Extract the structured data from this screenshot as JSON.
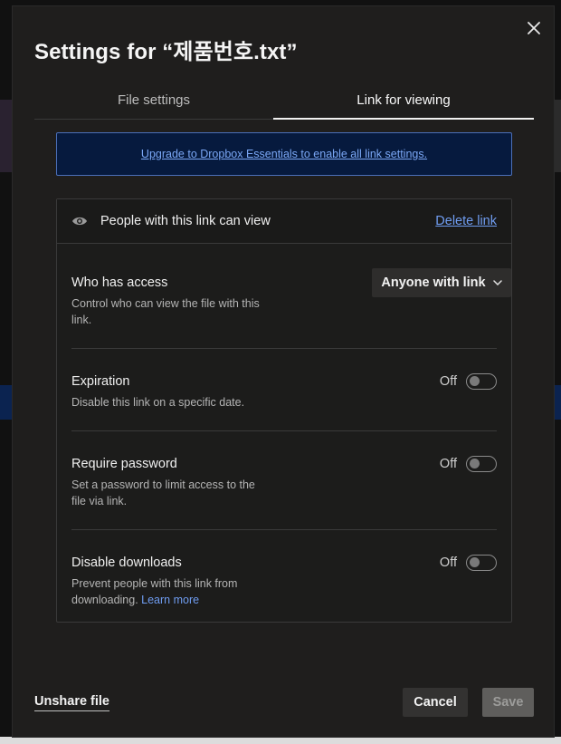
{
  "modal": {
    "title": "Settings for “제품번호.txt”",
    "close_icon": "close-icon"
  },
  "tabs": [
    {
      "label": "File settings",
      "active": false
    },
    {
      "label": "Link for viewing",
      "active": true
    }
  ],
  "banner": {
    "link_text": "Upgrade to Dropbox Essentials to enable all link settings."
  },
  "link_panel": {
    "header_label": "People with this link can view",
    "header_icon": "eye-icon",
    "delete_link": "Delete link",
    "who_has_access": {
      "title": "Who has access",
      "description": "Control who can view the file with this link.",
      "selected": "Anyone with link"
    },
    "expiration": {
      "title": "Expiration",
      "description": "Disable this link on a specific date.",
      "state": "Off"
    },
    "require_password": {
      "title": "Require password",
      "description": "Set a password to limit access to the file via link.",
      "state": "Off"
    },
    "disable_downloads": {
      "title": "Disable downloads",
      "description": "Prevent people with this link from downloading.",
      "learn_more": "Learn more",
      "state": "Off"
    }
  },
  "footer": {
    "unshare": "Unshare file",
    "cancel": "Cancel",
    "save": "Save"
  },
  "colors": {
    "modal_bg": "#1f1e1d",
    "banner_bg": "#061a3e",
    "link": "#6f9cf0",
    "save_disabled": "#5f5e5c"
  }
}
